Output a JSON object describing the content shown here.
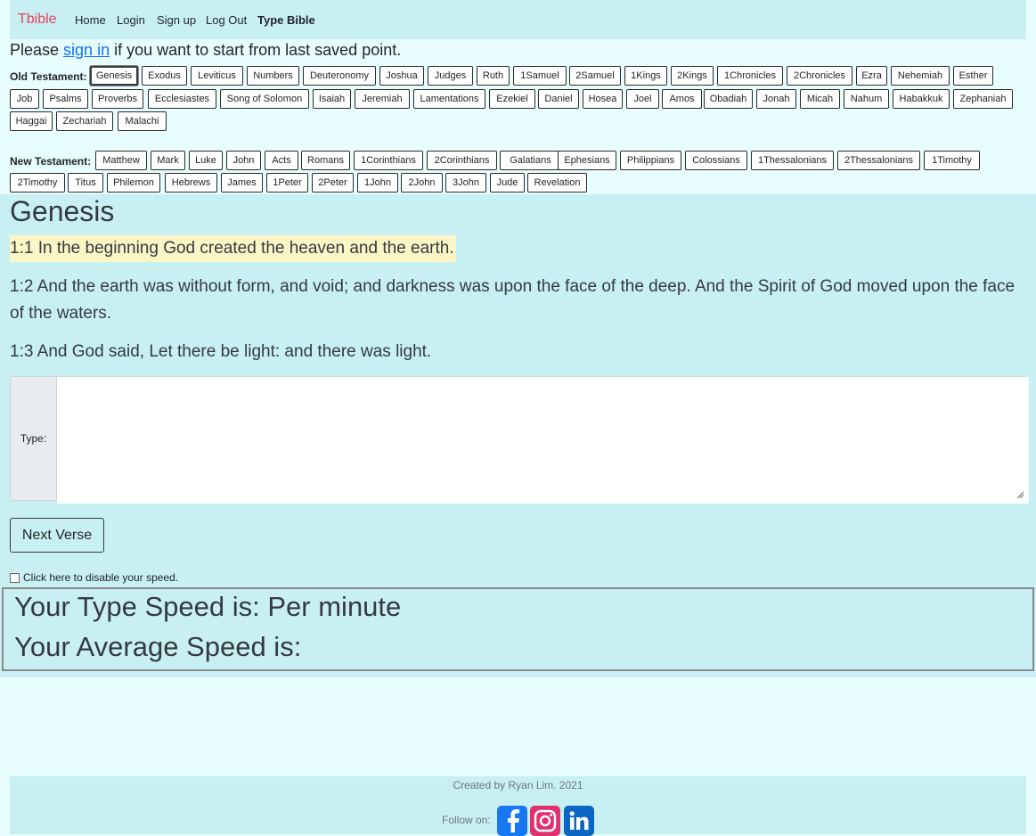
{
  "nav": {
    "brand": "Tbible",
    "links": [
      "Home",
      "Login",
      "Sign up",
      "Log Out",
      "Type Bible"
    ]
  },
  "signin": {
    "prefix": "Please ",
    "link": "sign in",
    "suffix": " if you want to start from last saved point."
  },
  "old_testament": {
    "label": "Old Testament:",
    "selected": "Genesis",
    "books": [
      "Genesis",
      "Exodus",
      "Leviticus",
      "Numbers",
      "Deuteronomy",
      "Joshua",
      "Judges",
      "Ruth",
      "1Samuel",
      "2Samuel",
      "1Kings",
      "2Kings",
      "1Chronicles",
      "2Chronicles",
      "Ezra",
      "Nehemiah",
      "Esther",
      "Job",
      "Psalms",
      "Proverbs",
      "Ecclesiastes",
      "Song of Solomon",
      "Isaiah",
      "Jeremiah",
      "Lamentations",
      "Ezekiel",
      "Daniel",
      "Hosea",
      "Joel",
      "Amos",
      "Obadiah",
      "Jonah",
      "Micah",
      "Nahum",
      "Habakkuk",
      "Zephaniah",
      "Haggai",
      "Zechariah",
      "Malachi"
    ]
  },
  "new_testament": {
    "label": "New Testament:",
    "books": [
      "Matthew",
      "Mark",
      "Luke",
      "John",
      "Acts",
      "Romans",
      "1Corinthians",
      "2Corinthians",
      "Galatians",
      "Ephesians",
      "Philippians",
      "Colossians",
      "1Thessalonians",
      "2Thessalonians",
      "1Timothy",
      "2Timothy",
      "Titus",
      "Philemon",
      "Hebrews",
      "James",
      "1Peter",
      "2Peter",
      "1John",
      "2John",
      "3John",
      "Jude",
      "Revelation"
    ]
  },
  "reading": {
    "book_title": "Genesis",
    "verses": [
      "1:1 In the beginning God created the heaven and the earth.",
      "1:2 And the earth was without form, and void; and darkness was upon the face of the deep. And the Spirit of God moved upon the face of the waters.",
      "1:3 And God said, Let there be light: and there was light."
    ]
  },
  "typing": {
    "label": "Type:",
    "value": ""
  },
  "next_button": "Next Verse",
  "disable_speed": "Click here to disable your speed.",
  "speed": {
    "type_speed": "Your Type Speed is: Per minute",
    "average_speed": "Your Average Speed is:"
  },
  "footer": {
    "credit": "Created by Ryan Lim. 2021",
    "follow": "Follow on:",
    "socials": [
      "facebook-icon",
      "instagram-icon",
      "linkedin-icon"
    ],
    "colors": {
      "facebook": "#1877f2",
      "instagram": "#e1306c",
      "linkedin": "#0a66c2"
    }
  }
}
